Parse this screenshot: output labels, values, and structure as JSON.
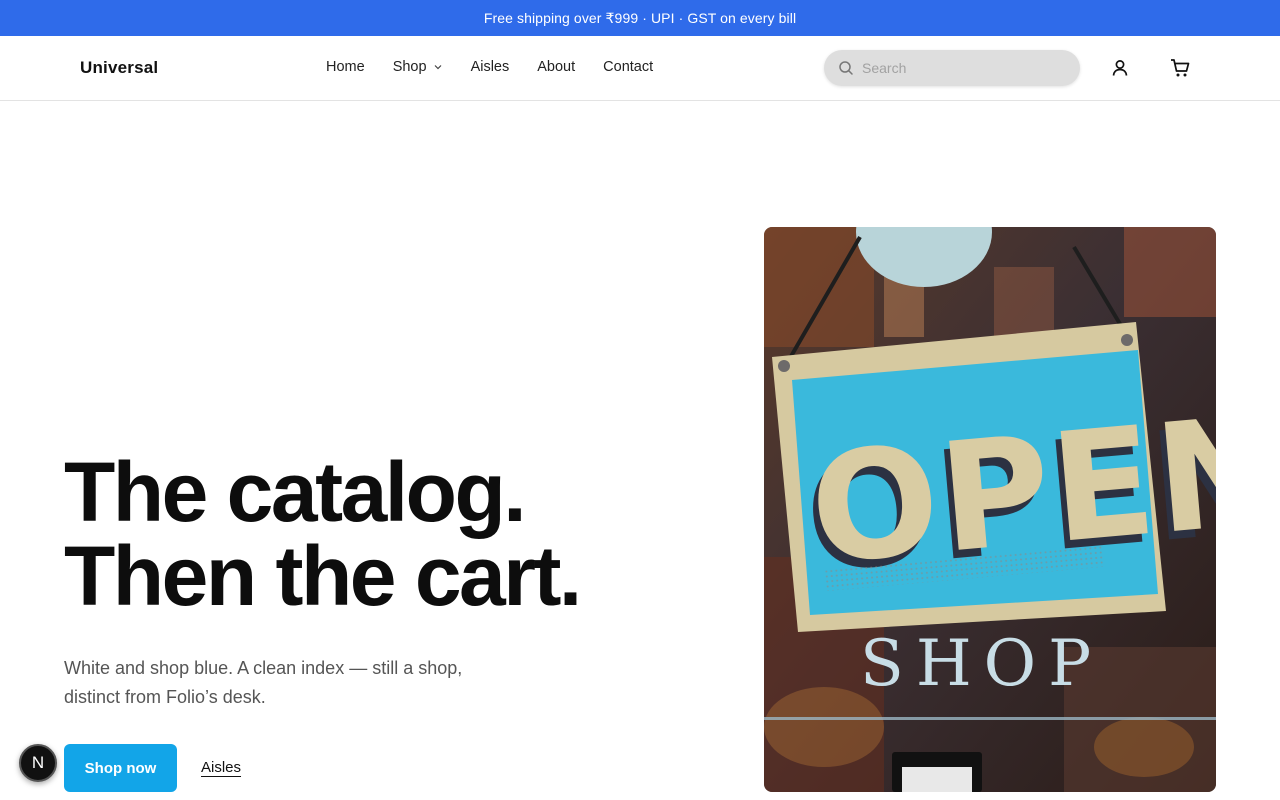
{
  "announcement": "Free shipping over ₹999 · UPI · GST on every bill",
  "brand": "Universal",
  "nav": {
    "home": "Home",
    "shop": "Shop",
    "aisles": "Aisles",
    "about": "About",
    "contact": "Contact"
  },
  "search": {
    "placeholder": "Search"
  },
  "hero": {
    "title_line1": "The catalog.",
    "title_line2": "Then the cart.",
    "subtitle": "White and shop blue. A clean index — still a shop, distinct from Folio’s desk.",
    "cta_label": "Shop now",
    "secondary_link": "Aisles",
    "image_sign_word": "OPEN",
    "image_caption_word": "SHOP"
  },
  "dev_badge": "N",
  "colors": {
    "announcement_bg": "#2f6bea",
    "cta_bg": "#12a5e8",
    "search_bg": "#dedede"
  },
  "icons": [
    "search-icon",
    "account-icon",
    "cart-icon",
    "chevron-down-icon"
  ]
}
